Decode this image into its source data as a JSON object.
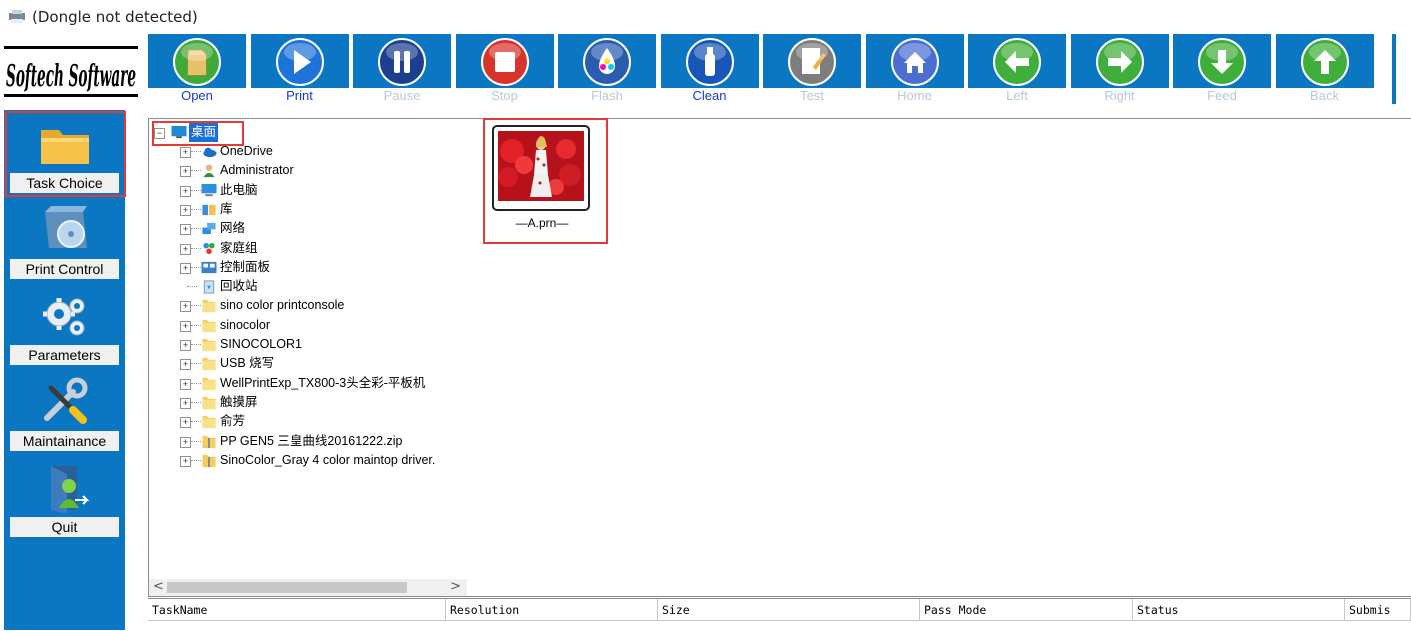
{
  "window": {
    "title": "(Dongle not detected)",
    "icon": "printer-icon"
  },
  "logo": {
    "text": "Softech Software"
  },
  "toolbar": {
    "buttons": [
      {
        "id": "open",
        "label": "Open",
        "icon": "folder-icon",
        "enabled": true,
        "color": "#3fa93a"
      },
      {
        "id": "print",
        "label": "Print",
        "icon": "play-icon",
        "enabled": true,
        "color": "#1e73d8"
      },
      {
        "id": "pause",
        "label": "Pause",
        "icon": "pause-icon",
        "enabled": false,
        "color": "#1d3f8f"
      },
      {
        "id": "stop",
        "label": "Stop",
        "icon": "stop-icon",
        "enabled": false,
        "color": "#d9342b"
      },
      {
        "id": "flash",
        "label": "Flash",
        "icon": "inkdrop-icon",
        "enabled": false,
        "color": "#2a5cb0"
      },
      {
        "id": "clean",
        "label": "Clean",
        "icon": "bottle-icon",
        "enabled": true,
        "color": "#1a56b8"
      },
      {
        "id": "test",
        "label": "Test",
        "icon": "document-edit-icon",
        "enabled": false,
        "color": "#7d7d7d"
      },
      {
        "id": "home",
        "label": "Home",
        "icon": "home-icon",
        "enabled": false,
        "color": "#4a6fd0"
      },
      {
        "id": "left",
        "label": "Left",
        "icon": "arrow-left-icon",
        "enabled": false,
        "color": "#3fae3a"
      },
      {
        "id": "right",
        "label": "Right",
        "icon": "arrow-right-icon",
        "enabled": false,
        "color": "#3fae3a"
      },
      {
        "id": "feed",
        "label": "Feed",
        "icon": "arrow-down-icon",
        "enabled": false,
        "color": "#3fae3a"
      },
      {
        "id": "back",
        "label": "Back",
        "icon": "arrow-up-icon",
        "enabled": false,
        "color": "#3fae3a"
      }
    ]
  },
  "sidebar": {
    "selected": "task-choice",
    "items": [
      {
        "id": "task-choice",
        "label": "Task Choice",
        "icon": "folder-icon"
      },
      {
        "id": "print-control",
        "label": "Print Control",
        "icon": "cd-icon"
      },
      {
        "id": "parameters",
        "label": "Parameters",
        "icon": "gears-icon"
      },
      {
        "id": "maintainance",
        "label": "Maintainance",
        "icon": "tools-icon"
      },
      {
        "id": "quit",
        "label": "Quit",
        "icon": "user-exit-icon"
      }
    ]
  },
  "tree": {
    "root": {
      "label": "桌面",
      "icon": "desktop-icon"
    },
    "items": [
      {
        "label": "OneDrive",
        "icon": "cloud-icon",
        "expandable": true
      },
      {
        "label": "Administrator",
        "icon": "user-icon",
        "expandable": true
      },
      {
        "label": "此电脑",
        "icon": "computer-icon",
        "expandable": true
      },
      {
        "label": "库",
        "icon": "library-icon",
        "expandable": true
      },
      {
        "label": "网络",
        "icon": "network-icon",
        "expandable": true
      },
      {
        "label": "家庭组",
        "icon": "homegroup-icon",
        "expandable": true
      },
      {
        "label": "控制面板",
        "icon": "control-panel-icon",
        "expandable": true
      },
      {
        "label": "回收站",
        "icon": "recycle-bin-icon",
        "expandable": false
      },
      {
        "label": "sino color printconsole",
        "icon": "folder-icon",
        "expandable": true
      },
      {
        "label": "sinocolor",
        "icon": "folder-icon",
        "expandable": true
      },
      {
        "label": "SINOCOLOR1",
        "icon": "folder-icon",
        "expandable": true
      },
      {
        "label": "USB 烧写",
        "icon": "folder-icon",
        "expandable": true
      },
      {
        "label": "WellPrintExp_TX800-3头全彩-平板机",
        "icon": "folder-icon",
        "expandable": true
      },
      {
        "label": "触摸屏",
        "icon": "folder-icon",
        "expandable": true
      },
      {
        "label": "俞芳",
        "icon": "folder-icon",
        "expandable": true
      },
      {
        "label": "PP GEN5 三皇曲线20161222.zip",
        "icon": "zip-icon",
        "expandable": true
      },
      {
        "label": "SinoColor_Gray 4 color maintop driver.",
        "icon": "zip-icon",
        "expandable": true
      }
    ]
  },
  "files": [
    {
      "name": "—A.prn—",
      "thumbnail": "photo-thumbnail"
    }
  ],
  "task_table": {
    "columns": [
      "TaskName",
      "Resolution",
      "Size",
      "Pass Mode",
      "Status",
      "Submis"
    ]
  }
}
